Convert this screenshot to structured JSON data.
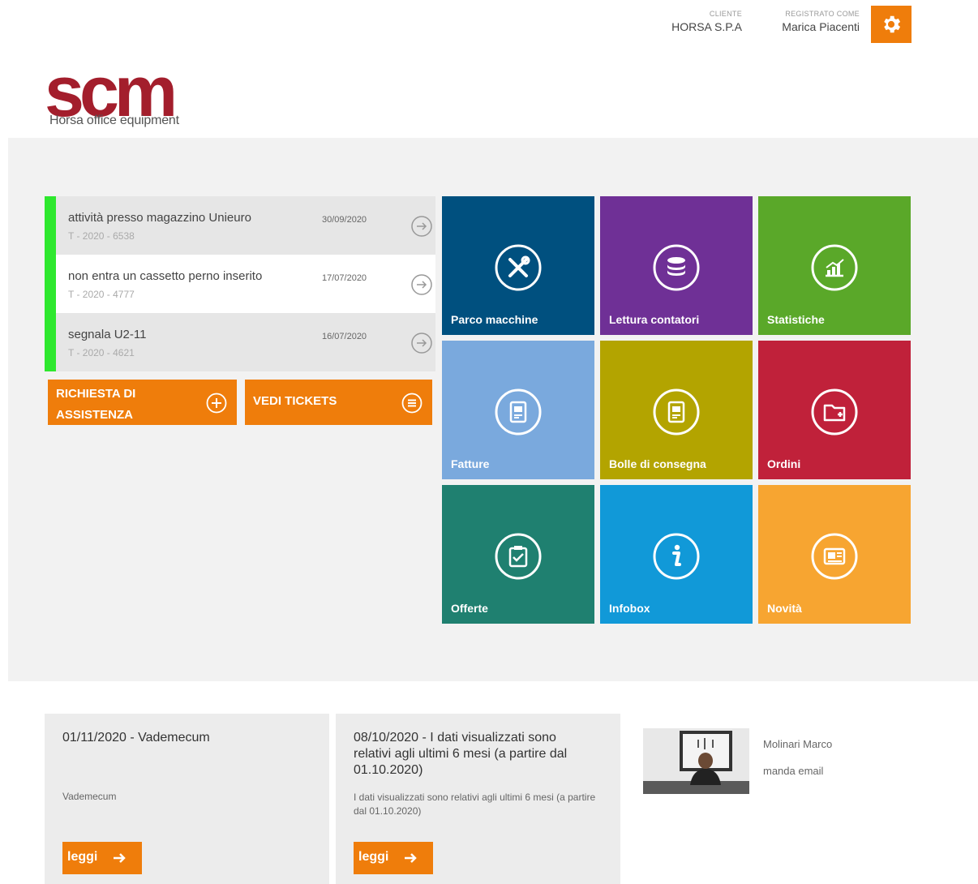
{
  "header": {
    "client_label": "CLIENTE",
    "client_name": "HORSA S.P.A",
    "user_label": "REGISTRATO COME",
    "user_name": "Marica Piacenti",
    "gear_icon": "gear-icon",
    "accent_color": "#ef7d0b"
  },
  "logo": {
    "main": "scm",
    "sub": "Horsa office equipment",
    "color": "#a31e2c"
  },
  "tickets": [
    {
      "title": "attività presso magazzino Unieuro",
      "code": "T - 2020 - 6538",
      "date": "30/09/2020"
    },
    {
      "title": "non entra un cassetto perno inserito",
      "code": "T - 2020 - 4777",
      "date": "17/07/2020"
    },
    {
      "title": "segnala U2-11",
      "code": "T - 2020 - 4621",
      "date": "16/07/2020"
    }
  ],
  "actions": {
    "request_line1": "RICHIESTA DI",
    "request_line2": "ASSISTENZA",
    "view_tickets": "VEDI TICKETS"
  },
  "tiles": [
    {
      "label": "Parco macchine",
      "color": "#00507f",
      "icon": "tools-icon"
    },
    {
      "label": "Lettura contatori",
      "color": "#6f3096",
      "icon": "database-icon"
    },
    {
      "label": "Statistiche",
      "color": "#5aa829",
      "icon": "chart-icon"
    },
    {
      "label": "Fatture",
      "color": "#7aa9dd",
      "icon": "invoice-icon"
    },
    {
      "label": "Bolle di consegna",
      "color": "#b3a400",
      "icon": "delivery-note-icon"
    },
    {
      "label": "Ordini",
      "color": "#c0213a",
      "icon": "folder-add-icon"
    },
    {
      "label": "Offerte",
      "color": "#1f8070",
      "icon": "clipboard-check-icon"
    },
    {
      "label": "Infobox",
      "color": "#1199d8",
      "icon": "info-icon"
    },
    {
      "label": "Novità",
      "color": "#f7a531",
      "icon": "news-icon"
    }
  ],
  "news": [
    {
      "title": "01/11/2020 - Vademecum",
      "body": "Vademecum",
      "button": "leggi"
    },
    {
      "title": "08/10/2020 - I dati visualizzati sono relativi agli ultimi 6 mesi (a partire dal 01.10.2020)",
      "body": "I dati visualizzati sono relativi agli ultimi 6 mesi (a partire dal 01.10.2020)",
      "button": "leggi"
    }
  ],
  "contact": {
    "name": "Molinari Marco",
    "email_link": "manda email"
  }
}
